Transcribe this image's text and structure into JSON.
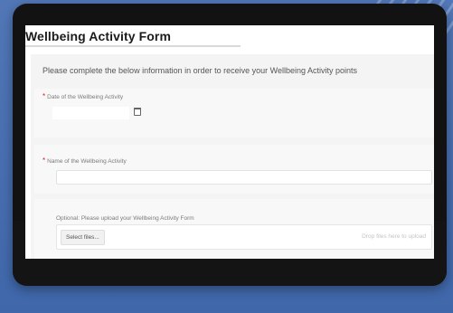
{
  "form": {
    "title": "Wellbeing Activity Form",
    "intro": "Please complete the below information in order to receive your Wellbeing Activity points"
  },
  "fields": {
    "date": {
      "required_mark": "*",
      "label": "Date of the Wellbeing Activity",
      "value": "",
      "icon": "calendar-icon"
    },
    "name": {
      "required_mark": "*",
      "label": "Name of the Wellbeing Activity",
      "value": ""
    },
    "upload": {
      "label": "Optional: Please upload your Wellbeing Activity Form",
      "button_label": "Select files...",
      "drop_hint": "Drop files here to upload"
    }
  },
  "colors": {
    "background": "#4a6fad",
    "device": "#121212",
    "required": "#d8202a"
  }
}
